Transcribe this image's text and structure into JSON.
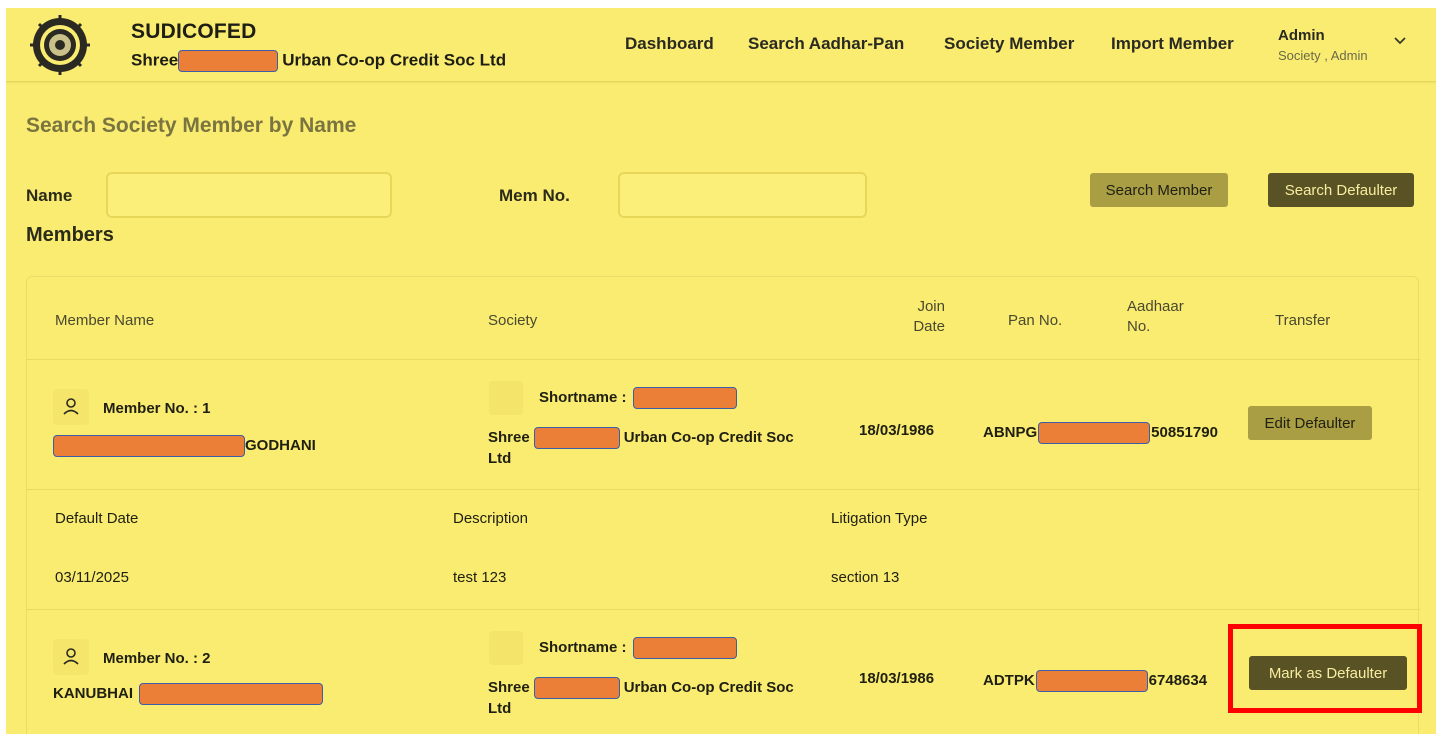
{
  "header": {
    "brand_title": "SUDICOFED",
    "brand_sub_prefix": "Shree",
    "brand_sub_suffix": "Urban Co-op Credit Soc Ltd",
    "nav": [
      "Dashboard",
      "Search Aadhar-Pan",
      "Society Member",
      "Import Member"
    ],
    "user_name": "Admin",
    "user_role": "Society , Admin"
  },
  "search": {
    "title": "Search Society Member by Name",
    "name_label": "Name",
    "name_value": "",
    "mem_label": "Mem No.",
    "mem_value": "",
    "search_member_label": "Search Member",
    "search_defaulter_label": "Search Defaulter"
  },
  "members": {
    "title": "Members",
    "columns": [
      "Member Name",
      "Society",
      "Join\nDate",
      "Pan No.",
      "Aadhaar\nNo.",
      "Transfer"
    ],
    "rows": [
      {
        "member_no": "Member No. : 1",
        "name_suffix": "GODHANI",
        "shortname_label": "Shortname :",
        "society_prefix": "Shree",
        "society_suffix": "Urban Co-op Credit Soc",
        "society_tail": "Ltd",
        "join_date": "18/03/1986",
        "pan_prefix": "ABNPG",
        "aadhaar_suffix": "50851790",
        "action": "Edit Defaulter"
      },
      {
        "member_no": "Member No. : 2",
        "name_prefix": "KANUBHAI",
        "shortname_label": "Shortname :",
        "society_prefix": "Shree",
        "society_suffix": "Urban Co-op Credit Soc",
        "society_tail": "Ltd",
        "join_date": "18/03/1986",
        "pan_prefix": "ADTPK",
        "aadhaar_suffix": "6748634",
        "action": "Mark as Defaulter"
      }
    ],
    "default_details": {
      "headers": [
        "Default Date",
        "Description",
        "Litigation Type"
      ],
      "values": [
        "03/11/2025",
        "test 123",
        "section 13"
      ]
    }
  },
  "colors": {
    "background": "#f9ec70",
    "dark_button": "#595225",
    "light_button": "#a99e44",
    "redaction": "#ec7f37",
    "highlight": "#ff0000"
  }
}
